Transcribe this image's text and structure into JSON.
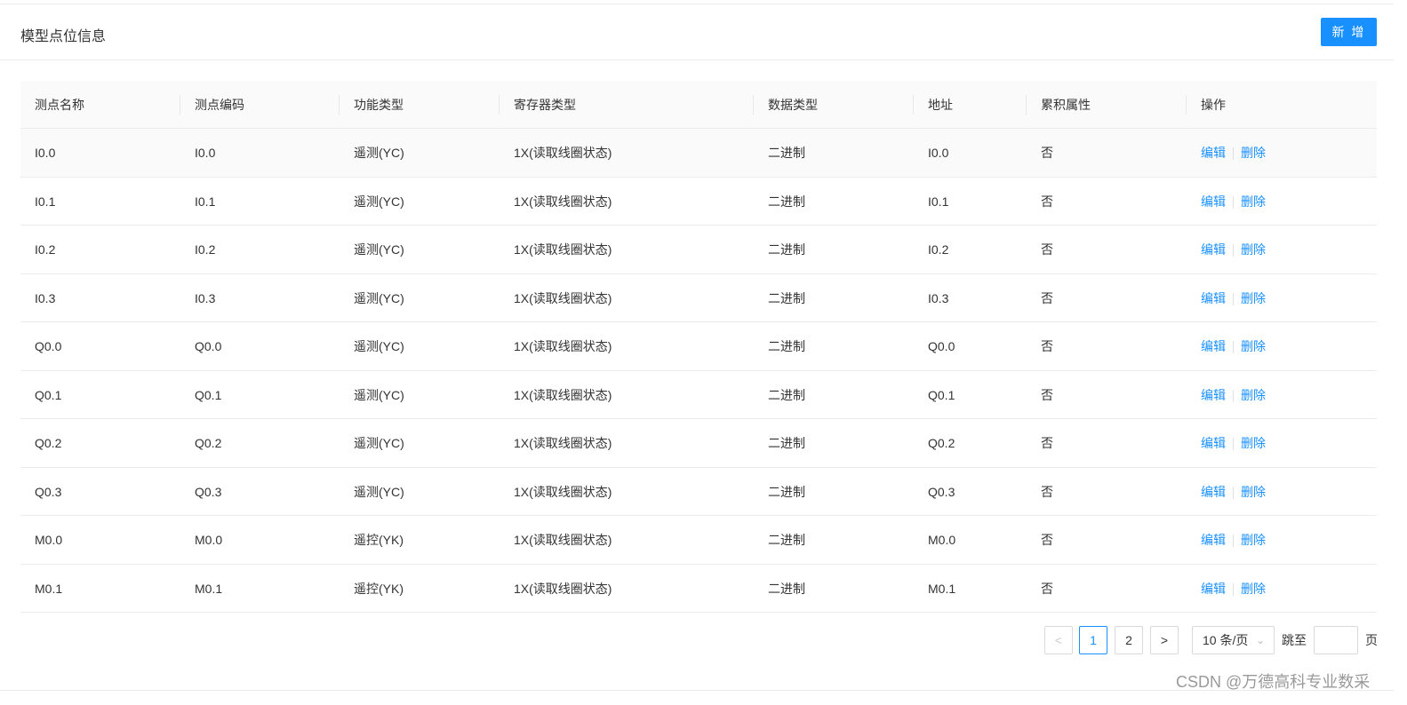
{
  "header": {
    "title": "模型点位信息",
    "add_label": "新 增"
  },
  "table": {
    "columns": [
      "测点名称",
      "测点编码",
      "功能类型",
      "寄存器类型",
      "数据类型",
      "地址",
      "累积属性",
      "操作"
    ],
    "actions": {
      "edit": "编辑",
      "delete": "删除"
    },
    "rows": [
      [
        "I0.0",
        "I0.0",
        "遥测(YC)",
        "1X(读取线圈状态)",
        "二进制",
        "I0.0",
        "否"
      ],
      [
        "I0.1",
        "I0.1",
        "遥测(YC)",
        "1X(读取线圈状态)",
        "二进制",
        "I0.1",
        "否"
      ],
      [
        "I0.2",
        "I0.2",
        "遥测(YC)",
        "1X(读取线圈状态)",
        "二进制",
        "I0.2",
        "否"
      ],
      [
        "I0.3",
        "I0.3",
        "遥测(YC)",
        "1X(读取线圈状态)",
        "二进制",
        "I0.3",
        "否"
      ],
      [
        "Q0.0",
        "Q0.0",
        "遥测(YC)",
        "1X(读取线圈状态)",
        "二进制",
        "Q0.0",
        "否"
      ],
      [
        "Q0.1",
        "Q0.1",
        "遥测(YC)",
        "1X(读取线圈状态)",
        "二进制",
        "Q0.1",
        "否"
      ],
      [
        "Q0.2",
        "Q0.2",
        "遥测(YC)",
        "1X(读取线圈状态)",
        "二进制",
        "Q0.2",
        "否"
      ],
      [
        "Q0.3",
        "Q0.3",
        "遥测(YC)",
        "1X(读取线圈状态)",
        "二进制",
        "Q0.3",
        "否"
      ],
      [
        "M0.0",
        "M0.0",
        "遥控(YK)",
        "1X(读取线圈状态)",
        "二进制",
        "M0.0",
        "否"
      ],
      [
        "M0.1",
        "M0.1",
        "遥控(YK)",
        "1X(读取线圈状态)",
        "二进制",
        "M0.1",
        "否"
      ]
    ]
  },
  "pagination": {
    "prev": "<",
    "pages": [
      "1",
      "2"
    ],
    "current": "1",
    "next": ">",
    "page_size": "10 条/页",
    "jump_label": "跳至",
    "jump_value": "",
    "page_suffix": "页"
  },
  "watermark": "CSDN @万德高科专业数采"
}
